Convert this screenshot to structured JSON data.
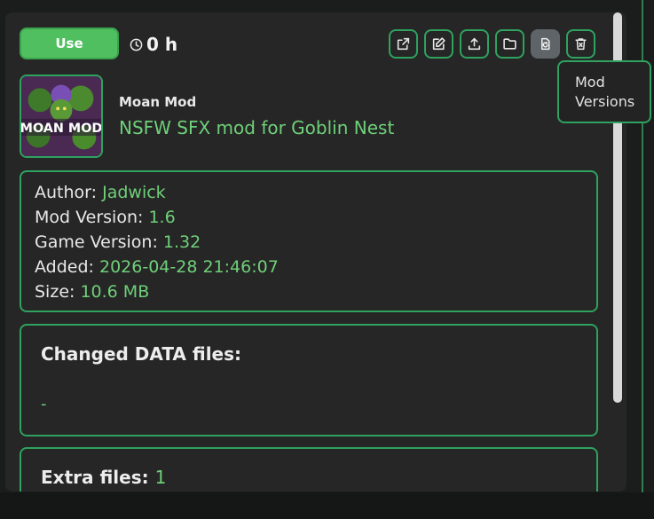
{
  "colors": {
    "accent": "#2ea25e",
    "value_text": "#6fd079",
    "use_button": "#4fbf5f",
    "panel": "#262626"
  },
  "header": {
    "use_label": "Use",
    "playtime": "0 h",
    "tools": [
      {
        "icon": "external-link-icon"
      },
      {
        "icon": "edit-icon"
      },
      {
        "icon": "upload-icon"
      },
      {
        "icon": "folder-icon"
      },
      {
        "icon": "mod-versions-icon",
        "active": true
      },
      {
        "icon": "trash-icon"
      }
    ]
  },
  "tooltip": {
    "line1": "Mod",
    "line2": "Versions"
  },
  "mod": {
    "name": "Moan Mod",
    "description": "NSFW SFX mod for Goblin Nest",
    "thumbnail_text": "MOAN MOD"
  },
  "info": {
    "author_label": "Author:",
    "author": "Jadwick",
    "mod_version_label": "Mod Version:",
    "mod_version": "1.6",
    "game_version_label": "Game Version:",
    "game_version": "1.32",
    "added_label": "Added:",
    "added": "2026-04-28 21:46:07",
    "size_label": "Size:",
    "size": "10.6 MB"
  },
  "changed_data": {
    "title": "Changed DATA files:",
    "value": "-"
  },
  "extra_files": {
    "title": "Extra files:",
    "count": "1"
  }
}
